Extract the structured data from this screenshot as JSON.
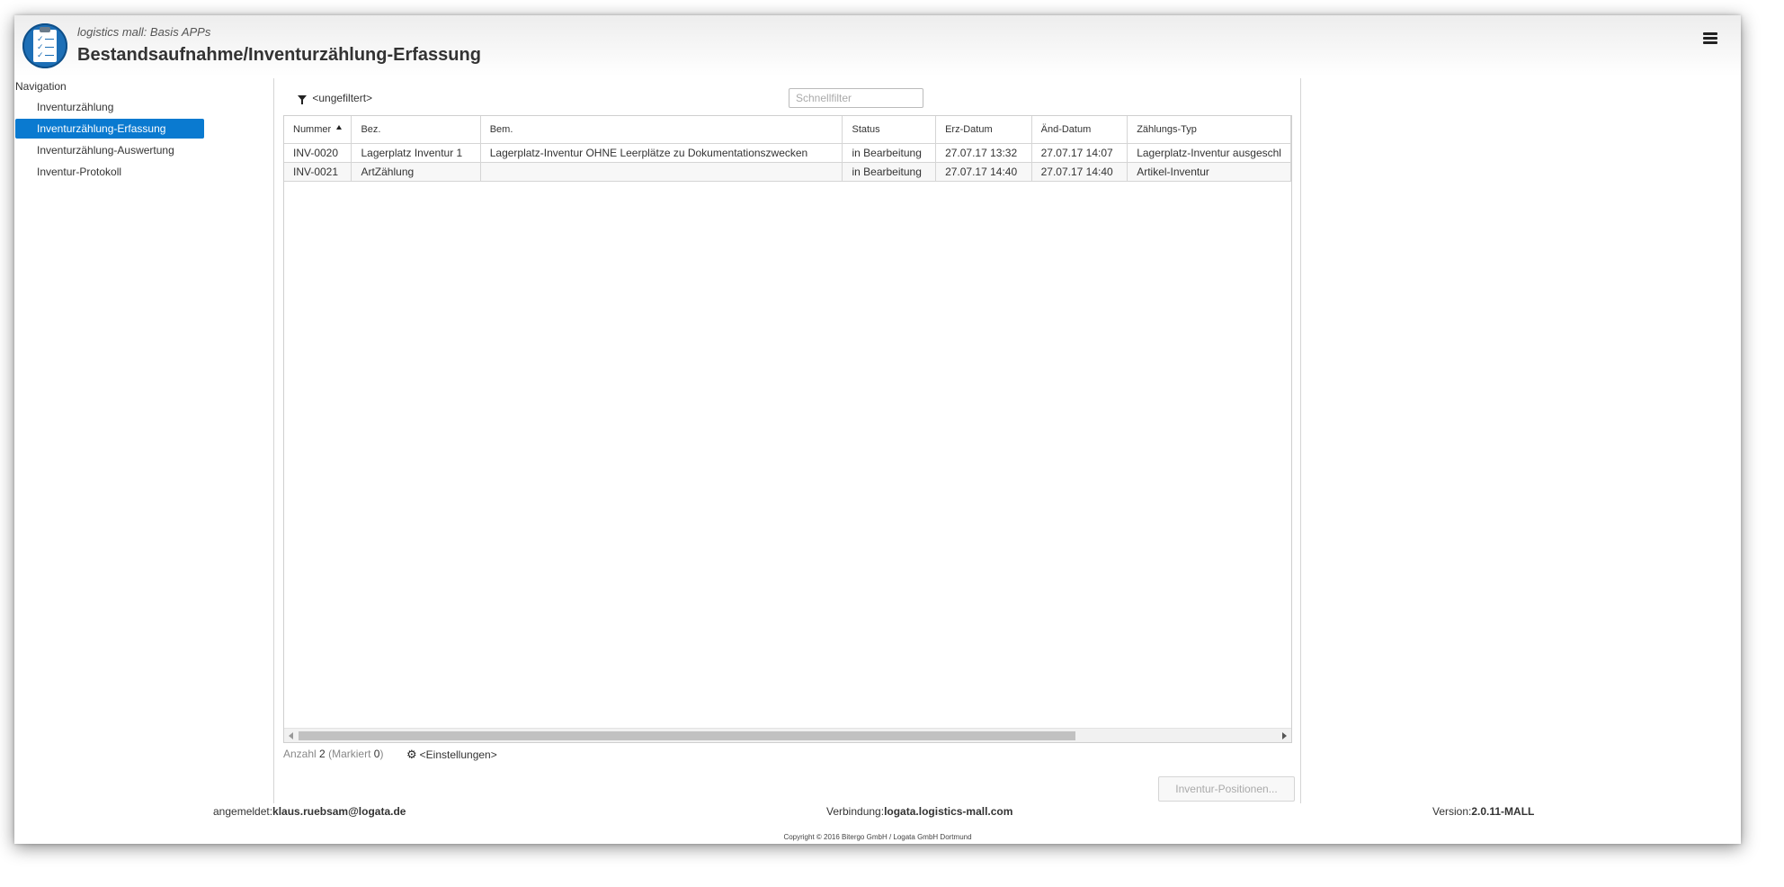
{
  "header": {
    "subtitle": "logistics mall: Basis APPs",
    "title": "Bestandsaufnahme/Inventurzählung-Erfassung"
  },
  "navigation": {
    "label": "Navigation",
    "items": [
      {
        "label": "Inventurzählung",
        "active": false
      },
      {
        "label": "Inventurzählung-Erfassung",
        "active": true
      },
      {
        "label": "Inventurzählung-Auswertung",
        "active": false
      },
      {
        "label": "Inventur-Protokoll",
        "active": false
      }
    ]
  },
  "toolbar": {
    "filter_label": "<ungefiltert>",
    "quickfilter_placeholder": "Schnellfilter"
  },
  "table": {
    "columns": [
      "Nummer",
      "Bez.",
      "Bem.",
      "Status",
      "Erz-Datum",
      "Änd-Datum",
      "Zählungs-Typ"
    ],
    "sort_column": "Nummer",
    "sort_direction": "asc",
    "rows": [
      [
        "INV-0020",
        "Lagerplatz Inventur 1",
        "Lagerplatz-Inventur OHNE Leerplätze zu Dokumentationszwecken",
        "in Bearbeitung",
        "27.07.17 13:32",
        "27.07.17 14:07",
        "Lagerplatz-Inventur ausgeschl"
      ],
      [
        "INV-0021",
        "ArtZählung",
        "",
        "in Bearbeitung",
        "27.07.17 14:40",
        "27.07.17 14:40",
        "Artikel-Inventur"
      ]
    ]
  },
  "status_bar": {
    "count_label": "Anzahl",
    "count": "2",
    "marked_label": "Markiert",
    "marked": "0",
    "settings_label": "<Einstellungen>"
  },
  "actions": {
    "positions_button": "Inventur-Positionen..."
  },
  "footer": {
    "logged_in_label": "angemeldet:",
    "user": "klaus.ruebsam@logata.de",
    "connection_label": "Verbindung:",
    "connection": "logata.logistics-mall.com",
    "version_label": "Version:",
    "version": "2.0.11-MALL",
    "copyright": "Copyright © 2016 Bitergo GmbH / Logata GmbH Dortmund"
  },
  "colors": {
    "accent": "#0a7ad0",
    "icon_bg": "#1d6fb6"
  }
}
